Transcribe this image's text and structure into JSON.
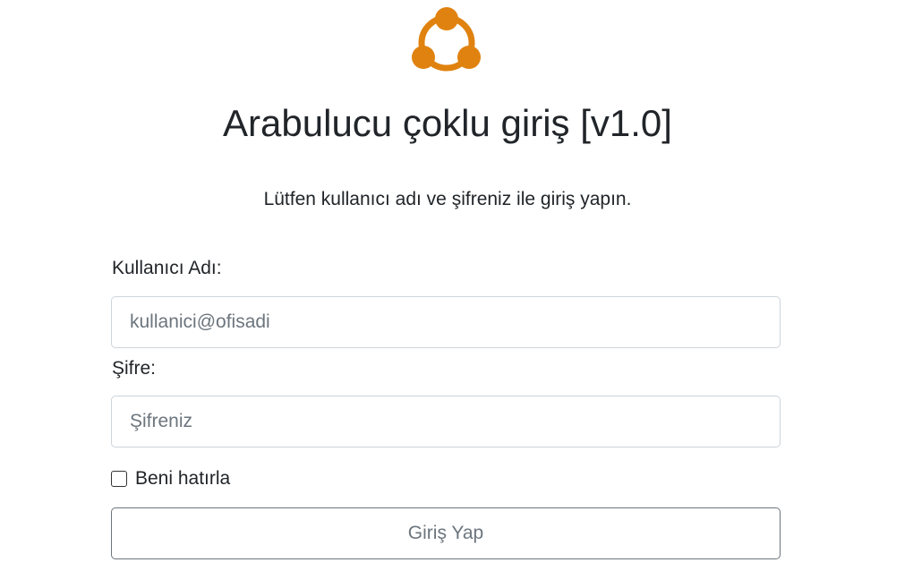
{
  "brand": {
    "logo_icon": "share-network-icon",
    "accent_color": "#E0820F"
  },
  "header": {
    "title": "Arabulucu çoklu giriş [v1.0]",
    "subtitle": "Lütfen kullanıcı adı ve şifreniz ile giriş yapın."
  },
  "form": {
    "username": {
      "label": "Kullanıcı Adı:",
      "value": "",
      "placeholder": "kullanici@ofisadi"
    },
    "password": {
      "label": "Şifre:",
      "value": "",
      "placeholder": "Şifreniz"
    },
    "remember": {
      "label": "Beni hatırla",
      "checked": false
    },
    "submit_label": "Giriş Yap"
  }
}
